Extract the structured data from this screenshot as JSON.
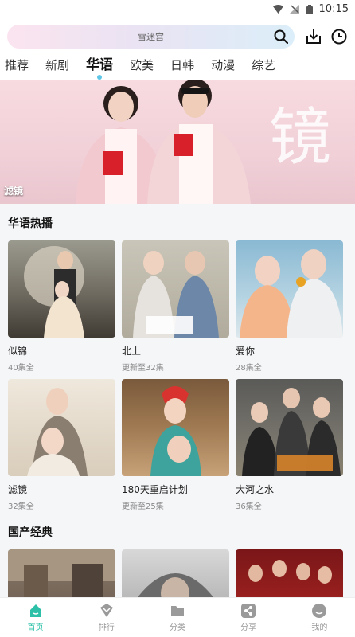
{
  "status": {
    "time": "10:15"
  },
  "search": {
    "placeholder": "雪迷宫"
  },
  "tabs": [
    {
      "label": "推荐"
    },
    {
      "label": "新剧"
    },
    {
      "label": "华语"
    },
    {
      "label": "欧美"
    },
    {
      "label": "日韩"
    },
    {
      "label": "动漫"
    },
    {
      "label": "综艺"
    }
  ],
  "banner": {
    "label": "滤镜",
    "bg_text": "镜"
  },
  "sections": [
    {
      "title": "华语热播",
      "items": [
        {
          "title": "似锦",
          "sub": "40集全"
        },
        {
          "title": "北上",
          "sub": "更新至32集"
        },
        {
          "title": "爱你",
          "sub": "28集全"
        },
        {
          "title": "滤镜",
          "sub": "32集全"
        },
        {
          "title": "180天重启计划",
          "sub": "更新至25集"
        },
        {
          "title": "大河之水",
          "sub": "36集全"
        }
      ]
    },
    {
      "title": "国产经典"
    }
  ],
  "nav": [
    {
      "label": "首页",
      "icon": "home-icon"
    },
    {
      "label": "排行",
      "icon": "ranking-icon"
    },
    {
      "label": "分类",
      "icon": "category-icon"
    },
    {
      "label": "分享",
      "icon": "share-icon"
    },
    {
      "label": "我的",
      "icon": "profile-icon"
    }
  ],
  "colors": {
    "accent": "#2cc0a8",
    "tab_dot": "#5ec7e8"
  }
}
